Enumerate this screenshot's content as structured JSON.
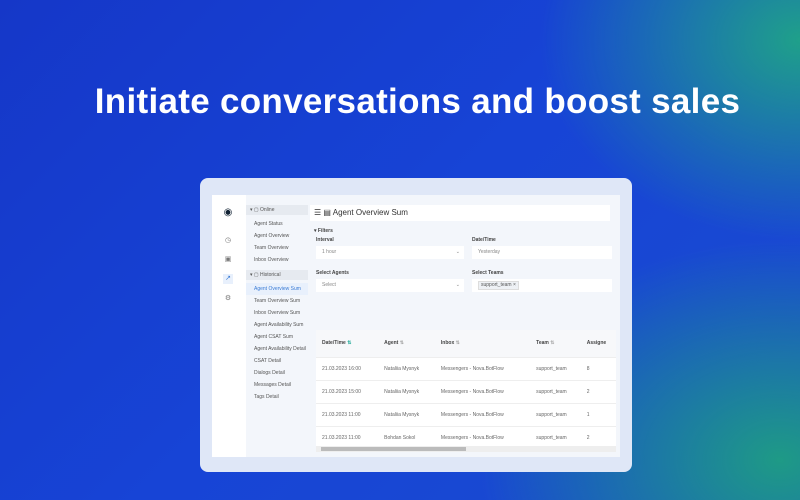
{
  "headline": "Initiate conversations and boost sales",
  "nav": {
    "online": "Online",
    "online_items": [
      "Agent Status",
      "Agent Overview",
      "Team Overview",
      "Inbox Overview"
    ],
    "historical": "Historical",
    "historical_items": [
      "Agent Overview Sum",
      "Team Overview Sum",
      "Inbox Overview Sum",
      "Agent Availability Sum",
      "Agent CSAT Sum",
      "Agent Availability Detail",
      "CSAT Detail",
      "Dialogs Detail",
      "Messages Detail",
      "Tags Detail"
    ]
  },
  "page_title": "Agent Overview Sum",
  "filters": {
    "label": "Filters",
    "interval_label": "Interval",
    "interval_value": "1 hour",
    "datetime_label": "Date/Time",
    "datetime_value": "Yesterday",
    "agents_label": "Select Agents",
    "agents_placeholder": "Select",
    "teams_label": "Select Teams",
    "teams_chip": "support_team"
  },
  "table": {
    "headers": [
      "Date/Time",
      "Agent",
      "Inbox",
      "Team",
      "Assigne"
    ],
    "rows": [
      [
        "21.03.2023 16:00",
        "Nataliia Mysnyk",
        "Messengers - Nova.BotFlow",
        "support_team",
        "8"
      ],
      [
        "21.03.2023 15:00",
        "Nataliia Mysnyk",
        "Messengers - Nova.BotFlow",
        "support_team",
        "2"
      ],
      [
        "21.03.2023 11:00",
        "Nataliia Mysnyk",
        "Messengers - Nova.BotFlow",
        "support_team",
        "1"
      ],
      [
        "21.03.2023 11:00",
        "Bohdan Sokol",
        "Messengers - Nova.BotFlow",
        "support_team",
        "2"
      ]
    ]
  }
}
